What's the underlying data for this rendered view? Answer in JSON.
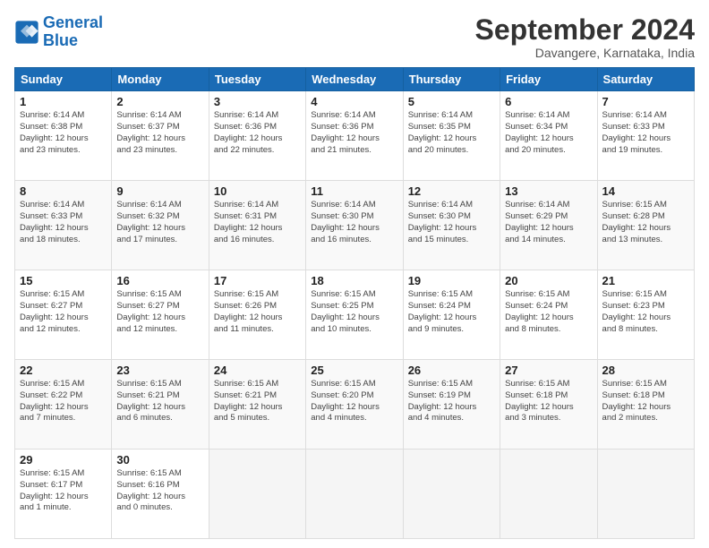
{
  "logo": {
    "text_general": "General",
    "text_blue": "Blue"
  },
  "header": {
    "month": "September 2024",
    "location": "Davangere, Karnataka, India"
  },
  "weekdays": [
    "Sunday",
    "Monday",
    "Tuesday",
    "Wednesday",
    "Thursday",
    "Friday",
    "Saturday"
  ],
  "weeks": [
    [
      {
        "day": "1",
        "sunrise": "Sunrise: 6:14 AM",
        "sunset": "Sunset: 6:38 PM",
        "daylight": "Daylight: 12 hours and 23 minutes."
      },
      {
        "day": "2",
        "sunrise": "Sunrise: 6:14 AM",
        "sunset": "Sunset: 6:37 PM",
        "daylight": "Daylight: 12 hours and 23 minutes."
      },
      {
        "day": "3",
        "sunrise": "Sunrise: 6:14 AM",
        "sunset": "Sunset: 6:36 PM",
        "daylight": "Daylight: 12 hours and 22 minutes."
      },
      {
        "day": "4",
        "sunrise": "Sunrise: 6:14 AM",
        "sunset": "Sunset: 6:36 PM",
        "daylight": "Daylight: 12 hours and 21 minutes."
      },
      {
        "day": "5",
        "sunrise": "Sunrise: 6:14 AM",
        "sunset": "Sunset: 6:35 PM",
        "daylight": "Daylight: 12 hours and 20 minutes."
      },
      {
        "day": "6",
        "sunrise": "Sunrise: 6:14 AM",
        "sunset": "Sunset: 6:34 PM",
        "daylight": "Daylight: 12 hours and 20 minutes."
      },
      {
        "day": "7",
        "sunrise": "Sunrise: 6:14 AM",
        "sunset": "Sunset: 6:33 PM",
        "daylight": "Daylight: 12 hours and 19 minutes."
      }
    ],
    [
      {
        "day": "8",
        "sunrise": "Sunrise: 6:14 AM",
        "sunset": "Sunset: 6:33 PM",
        "daylight": "Daylight: 12 hours and 18 minutes."
      },
      {
        "day": "9",
        "sunrise": "Sunrise: 6:14 AM",
        "sunset": "Sunset: 6:32 PM",
        "daylight": "Daylight: 12 hours and 17 minutes."
      },
      {
        "day": "10",
        "sunrise": "Sunrise: 6:14 AM",
        "sunset": "Sunset: 6:31 PM",
        "daylight": "Daylight: 12 hours and 16 minutes."
      },
      {
        "day": "11",
        "sunrise": "Sunrise: 6:14 AM",
        "sunset": "Sunset: 6:30 PM",
        "daylight": "Daylight: 12 hours and 16 minutes."
      },
      {
        "day": "12",
        "sunrise": "Sunrise: 6:14 AM",
        "sunset": "Sunset: 6:30 PM",
        "daylight": "Daylight: 12 hours and 15 minutes."
      },
      {
        "day": "13",
        "sunrise": "Sunrise: 6:14 AM",
        "sunset": "Sunset: 6:29 PM",
        "daylight": "Daylight: 12 hours and 14 minutes."
      },
      {
        "day": "14",
        "sunrise": "Sunrise: 6:15 AM",
        "sunset": "Sunset: 6:28 PM",
        "daylight": "Daylight: 12 hours and 13 minutes."
      }
    ],
    [
      {
        "day": "15",
        "sunrise": "Sunrise: 6:15 AM",
        "sunset": "Sunset: 6:27 PM",
        "daylight": "Daylight: 12 hours and 12 minutes."
      },
      {
        "day": "16",
        "sunrise": "Sunrise: 6:15 AM",
        "sunset": "Sunset: 6:27 PM",
        "daylight": "Daylight: 12 hours and 12 minutes."
      },
      {
        "day": "17",
        "sunrise": "Sunrise: 6:15 AM",
        "sunset": "Sunset: 6:26 PM",
        "daylight": "Daylight: 12 hours and 11 minutes."
      },
      {
        "day": "18",
        "sunrise": "Sunrise: 6:15 AM",
        "sunset": "Sunset: 6:25 PM",
        "daylight": "Daylight: 12 hours and 10 minutes."
      },
      {
        "day": "19",
        "sunrise": "Sunrise: 6:15 AM",
        "sunset": "Sunset: 6:24 PM",
        "daylight": "Daylight: 12 hours and 9 minutes."
      },
      {
        "day": "20",
        "sunrise": "Sunrise: 6:15 AM",
        "sunset": "Sunset: 6:24 PM",
        "daylight": "Daylight: 12 hours and 8 minutes."
      },
      {
        "day": "21",
        "sunrise": "Sunrise: 6:15 AM",
        "sunset": "Sunset: 6:23 PM",
        "daylight": "Daylight: 12 hours and 8 minutes."
      }
    ],
    [
      {
        "day": "22",
        "sunrise": "Sunrise: 6:15 AM",
        "sunset": "Sunset: 6:22 PM",
        "daylight": "Daylight: 12 hours and 7 minutes."
      },
      {
        "day": "23",
        "sunrise": "Sunrise: 6:15 AM",
        "sunset": "Sunset: 6:21 PM",
        "daylight": "Daylight: 12 hours and 6 minutes."
      },
      {
        "day": "24",
        "sunrise": "Sunrise: 6:15 AM",
        "sunset": "Sunset: 6:21 PM",
        "daylight": "Daylight: 12 hours and 5 minutes."
      },
      {
        "day": "25",
        "sunrise": "Sunrise: 6:15 AM",
        "sunset": "Sunset: 6:20 PM",
        "daylight": "Daylight: 12 hours and 4 minutes."
      },
      {
        "day": "26",
        "sunrise": "Sunrise: 6:15 AM",
        "sunset": "Sunset: 6:19 PM",
        "daylight": "Daylight: 12 hours and 4 minutes."
      },
      {
        "day": "27",
        "sunrise": "Sunrise: 6:15 AM",
        "sunset": "Sunset: 6:18 PM",
        "daylight": "Daylight: 12 hours and 3 minutes."
      },
      {
        "day": "28",
        "sunrise": "Sunrise: 6:15 AM",
        "sunset": "Sunset: 6:18 PM",
        "daylight": "Daylight: 12 hours and 2 minutes."
      }
    ],
    [
      {
        "day": "29",
        "sunrise": "Sunrise: 6:15 AM",
        "sunset": "Sunset: 6:17 PM",
        "daylight": "Daylight: 12 hours and 1 minute."
      },
      {
        "day": "30",
        "sunrise": "Sunrise: 6:15 AM",
        "sunset": "Sunset: 6:16 PM",
        "daylight": "Daylight: 12 hours and 0 minutes."
      },
      null,
      null,
      null,
      null,
      null
    ]
  ]
}
